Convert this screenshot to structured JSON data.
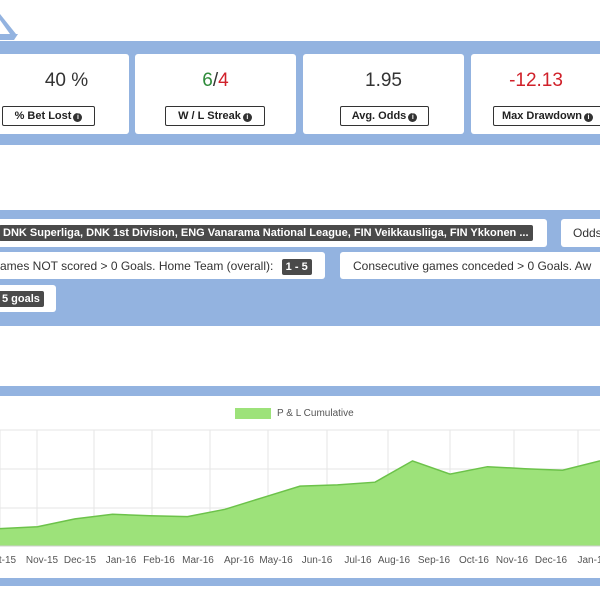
{
  "stats": [
    {
      "key": "bet_lost",
      "value": "40 %",
      "label": "% Bet Lost"
    },
    {
      "key": "wl_streak",
      "value_w": "6",
      "value_sep": "/",
      "value_l": "4",
      "label": "W / L Streak"
    },
    {
      "key": "avg_odds",
      "value": "1.95",
      "label": "Avg. Odds"
    },
    {
      "key": "max_drawdown",
      "value": "-12.13",
      "label": "Max Drawdown"
    }
  ],
  "info_icon": "info-circle-icon",
  "filters": {
    "leagues": "DNK Superliga, DNK 1st Division, ENG Vanarama National League, FIN Veikkausliiga, FIN Ykkonen ...",
    "odds_label": "Odds",
    "cond1_text": "ames NOT scored > 0 Goals. Home Team (overall):",
    "cond1_tag": "1 - 5",
    "cond2_text": "Consecutive games conceded > 0 Goals. Aw",
    "cond3_tag": "5 goals"
  },
  "colors": {
    "band": "#93b3e0",
    "fill": "#9de27a",
    "line": "#6cc24a",
    "positive": "#2e8b3a",
    "negative": "#d0212a"
  },
  "chart_data": {
    "type": "area",
    "series": [
      {
        "name": "P & L Cumulative",
        "values": [
          4.5,
          5.0,
          7.0,
          8.2,
          7.8,
          7.6,
          9.5,
          12.5,
          15.5,
          15.8,
          16.5,
          22.0,
          18.6,
          20.5,
          20.0,
          19.6,
          22.0
        ]
      }
    ],
    "x_tick_labels": [
      "ct-15",
      "Nov-15",
      "Dec-15",
      "Jan-16",
      "Feb-16",
      "Mar-16",
      "Apr-16",
      "May-16",
      "Jun-16",
      "Jul-16",
      "Aug-16",
      "Sep-16",
      "Oct-16",
      "Nov-16",
      "Dec-16",
      "Jan-1"
    ],
    "grid": true
  }
}
